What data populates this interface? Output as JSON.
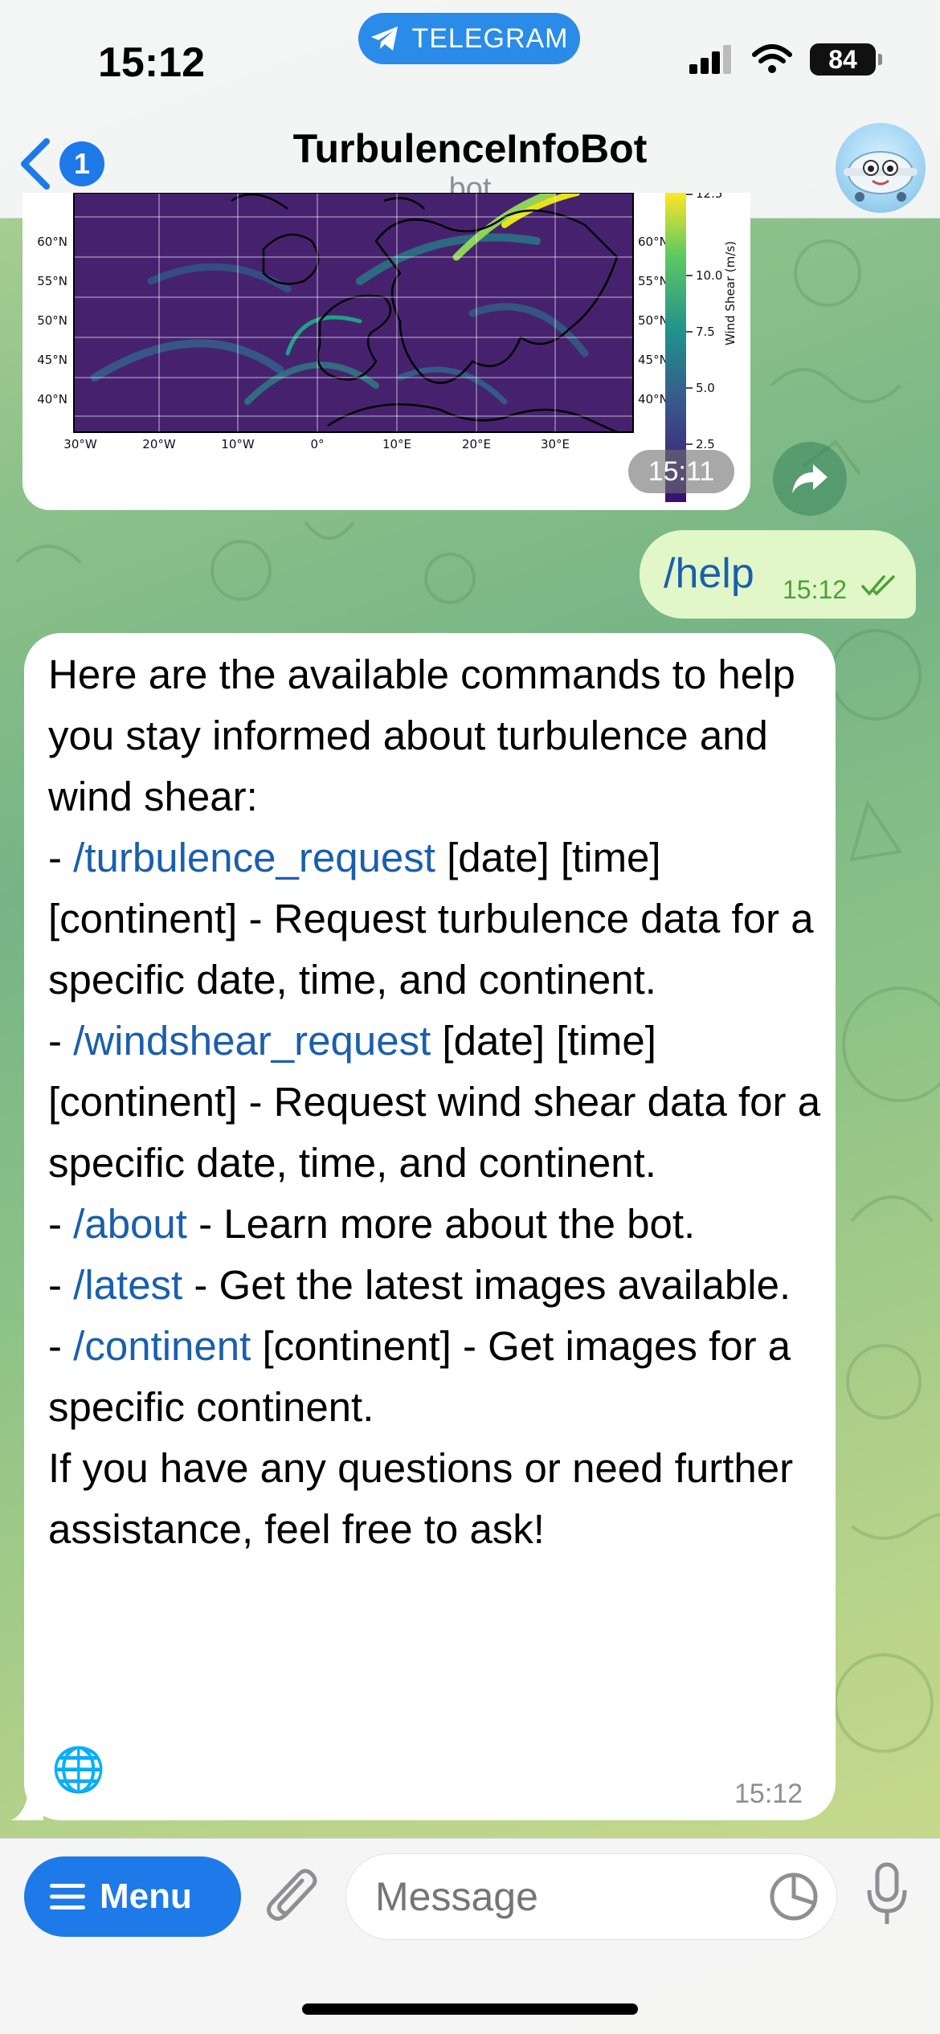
{
  "status_bar": {
    "time": "15:12",
    "app_pill": "TELEGRAM",
    "battery": "84"
  },
  "header": {
    "unread_count": "1",
    "title": "TurbulenceInfoBot",
    "subtitle": "bot"
  },
  "image_message": {
    "colorbar_label": "Wind Shear (m/s)",
    "colorbar_ticks": [
      "12.5",
      "10.0",
      "7.5",
      "5.0",
      "2.5"
    ],
    "lat_labels": [
      "60°N",
      "55°N",
      "50°N",
      "45°N",
      "40°N"
    ],
    "lon_labels": [
      "30°W",
      "20°W",
      "10°W",
      "0°",
      "10°E",
      "20°E",
      "30°E"
    ],
    "time": "15:11"
  },
  "outgoing_message": {
    "text": "/help",
    "time": "15:12"
  },
  "help_message": {
    "intro": "Here are the available commands to help you stay informed about turbulence and wind shear:",
    "commands": [
      {
        "cmd": "/turbulence_request",
        "text": " [date] [time] [continent] - Request turbulence data for a specific date, time, and continent."
      },
      {
        "cmd": "/windshear_request",
        "text": " [date] [time] [continent] - Request wind shear data for a specific date, time, and continent."
      },
      {
        "cmd": "/about",
        "text": " - Learn more about the bot."
      },
      {
        "cmd": "/latest",
        "text": " - Get the latest images available."
      },
      {
        "cmd": "/continent",
        "text": " [continent] - Get images for a specific continent."
      }
    ],
    "outro": "If you have any questions or need further assistance, feel free to ask!",
    "emoji": "🌐",
    "time": "15:12"
  },
  "composer": {
    "menu_label": "Menu",
    "placeholder": "Message"
  },
  "colors": {
    "accent": "#1d7ae8",
    "link": "#1a5fae",
    "outgoing_bubble": "#e2f7c8"
  }
}
